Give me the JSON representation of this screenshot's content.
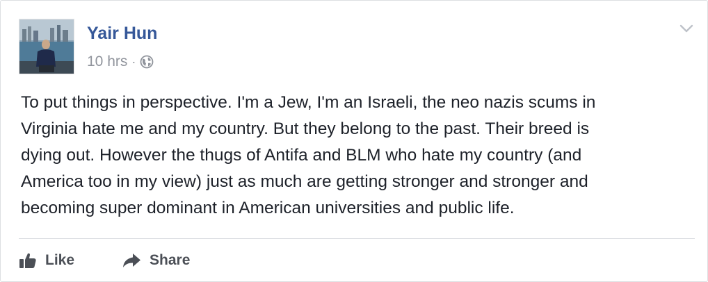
{
  "post": {
    "author_name": "Yair Hun",
    "timestamp": "10 hrs",
    "separator": "·",
    "privacy_icon": "globe-icon",
    "options_icon": "chevron-down-icon",
    "text_lines": [
      "To put things in perspective. I'm a Jew, I'm an Israeli, the neo nazis scums in",
      "Virginia hate me and my country. But they belong to the past. Their breed is",
      "dying out. However the thugs of Antifa and BLM who hate my country (and",
      "America too in my view) just as much are getting stronger and stronger and",
      "becoming super dominant in American universities and public life."
    ]
  },
  "actions": {
    "like_label": "Like",
    "like_icon": "thumbs-up-icon",
    "share_label": "Share",
    "share_icon": "share-arrow-icon"
  },
  "colors": {
    "author_link": "#365899",
    "meta_text": "#90949c",
    "body_text": "#1d2129",
    "action_text": "#4b4f56",
    "border": "#dddfe2"
  }
}
